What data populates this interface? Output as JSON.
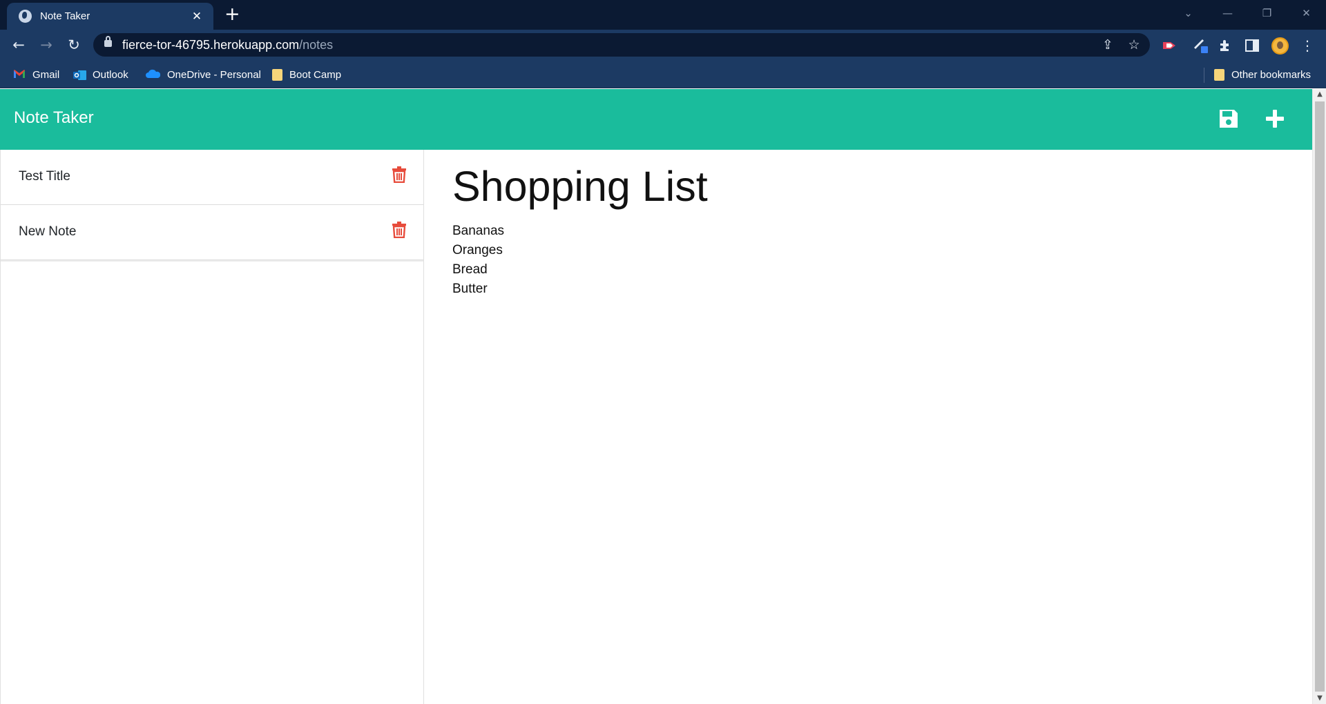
{
  "browser": {
    "tab_title": "Note Taker",
    "url_host": "fierce-tor-46795.herokuapp.com",
    "url_path": "/notes",
    "bookmarks": [
      {
        "label": "Gmail",
        "icon": "gmail-icon"
      },
      {
        "label": "Outlook",
        "icon": "outlook-icon"
      },
      {
        "label": "OneDrive - Personal",
        "icon": "onedrive-icon"
      },
      {
        "label": "Boot Camp",
        "icon": "folder-icon"
      }
    ],
    "other_bookmarks": "Other bookmarks"
  },
  "app": {
    "brand": "Note Taker",
    "accent_color": "#1abc9c",
    "delete_color": "#e74c3c",
    "notes": [
      {
        "title": "Test Title"
      },
      {
        "title": "New Note"
      }
    ],
    "active_note": {
      "title": "Shopping List",
      "lines": [
        "Bananas",
        "Oranges",
        "Bread",
        "Butter"
      ]
    }
  }
}
